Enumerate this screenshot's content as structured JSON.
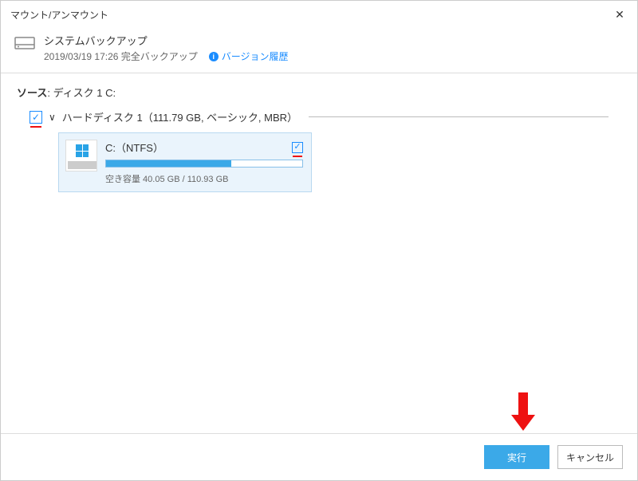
{
  "window": {
    "title": "マウント/アンマウント"
  },
  "header": {
    "backup_name": "システムバックアップ",
    "backup_info": "2019/03/19 17:26 完全バックアップ",
    "version_link": "バージョン履歴"
  },
  "source": {
    "label": "ソース",
    "value": "ディスク 1 C:"
  },
  "disk": {
    "label": "ハードディスク 1（111.79 GB, ベーシック, MBR）",
    "checked": true
  },
  "partition": {
    "title": "C:（NTFS）",
    "checked": true,
    "fill_pct": 64,
    "capacity_label": "空き容量 40.05 GB / 110.93 GB"
  },
  "footer": {
    "execute": "実行",
    "cancel": "キャンセル"
  }
}
